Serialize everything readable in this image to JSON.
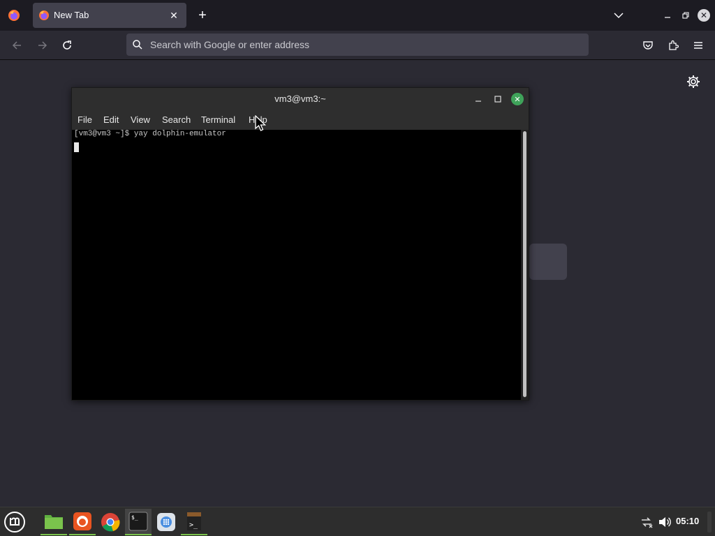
{
  "browser": {
    "tab": {
      "title": "New Tab"
    },
    "urlbar": {
      "placeholder": "Search with Google or enter address"
    }
  },
  "terminal": {
    "title": "vm3@vm3:~",
    "menu": [
      "File",
      "Edit",
      "View",
      "Search",
      "Terminal",
      "Help"
    ],
    "lines": [
      "[vm3@vm3 ~]$ yay dolphin-emulator"
    ]
  },
  "taskbar": {
    "clock": "05:10",
    "apps": [
      "menu-icon",
      "files-icon",
      "firefox-icon",
      "chrome-icon",
      "terminal-icon",
      "web-app-icon",
      "terminal-alt-icon"
    ]
  },
  "colors": {
    "accent": "#7ac34c",
    "terminal_close": "#3fa35a",
    "firefox_bg": "#2b2a33"
  }
}
